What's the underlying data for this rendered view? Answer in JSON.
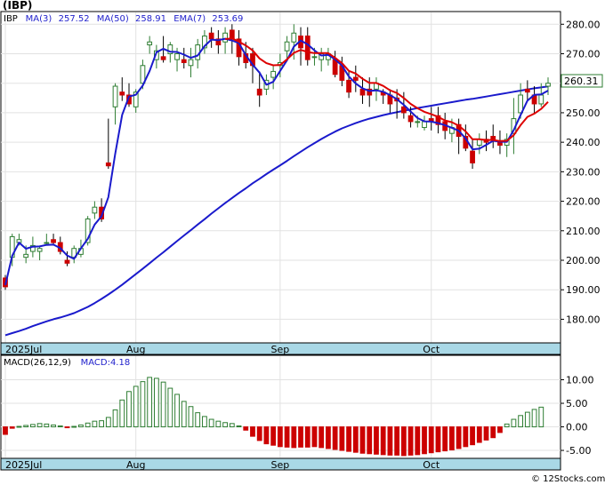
{
  "title": "(IBP)",
  "credit": "© 12Stocks.com",
  "legend": [
    {
      "label": "IBP",
      "color": "#000000"
    },
    {
      "label": "MA(3)",
      "color": "#2222cc"
    },
    {
      "label": "257.52",
      "color": "#2222cc"
    },
    {
      "label": "MA(50)",
      "color": "#2222cc"
    },
    {
      "label": "258.91",
      "color": "#2222cc"
    },
    {
      "label": "EMA(7)",
      "color": "#2222cc"
    },
    {
      "label": "253.69",
      "color": "#2222cc"
    }
  ],
  "macd_legend": [
    {
      "label": "MACD(26,12,9)",
      "color": "#000000"
    },
    {
      "label": "MACD:4.18",
      "color": "#2222cc"
    }
  ],
  "last_price_label": "260.31",
  "colors": {
    "up": "#2e7d32",
    "down": "#cc0000",
    "ma": "#1a1acc",
    "ema": "#dd0000",
    "axis_band": "#a9d8e6",
    "bg": "#ffffff"
  },
  "chart_data": [
    {
      "type": "candlestick",
      "title": "(IBP)",
      "ylim": [
        172,
        284
      ],
      "yticks": [
        180,
        190,
        200,
        210,
        220,
        230,
        240,
        250,
        260,
        270,
        280
      ],
      "ytick_labels": [
        "180.00",
        "190.00",
        "200.00",
        "210.00",
        "220.00",
        "230.00",
        "240.00",
        "250.00",
        "260.00",
        "270.00",
        "280.00"
      ],
      "xtick_labels": [
        {
          "label": "2025Jul",
          "index": 0
        },
        {
          "label": "Aug",
          "index": 19
        },
        {
          "label": "Sep",
          "index": 40
        },
        {
          "label": "Oct",
          "index": 62
        }
      ],
      "ohlc": [
        [
          194,
          195,
          190,
          191
        ],
        [
          201,
          209,
          198,
          208
        ],
        [
          206,
          209,
          205,
          207
        ],
        [
          201,
          205,
          199,
          202
        ],
        [
          203,
          208,
          201,
          205
        ],
        [
          203,
          205,
          200,
          204
        ],
        [
          206,
          209,
          205,
          206
        ],
        [
          207,
          209,
          205,
          206
        ],
        [
          206,
          208,
          202,
          203
        ],
        [
          200,
          203,
          198,
          199
        ],
        [
          201,
          205,
          199,
          204
        ],
        [
          202,
          207,
          201,
          204
        ],
        [
          206,
          215,
          205,
          214
        ],
        [
          216,
          220,
          214,
          218
        ],
        [
          218,
          221,
          213,
          214
        ],
        [
          233,
          248,
          231,
          232
        ],
        [
          252,
          260,
          246,
          259
        ],
        [
          257,
          262,
          254,
          256
        ],
        [
          256,
          260,
          252,
          253
        ],
        [
          252,
          258,
          250,
          257
        ],
        [
          260,
          268,
          258,
          266
        ],
        [
          273,
          276,
          270,
          274
        ],
        [
          268,
          273,
          265,
          271
        ],
        [
          269,
          276,
          267,
          268
        ],
        [
          270,
          274,
          267,
          273
        ],
        [
          268,
          272,
          264,
          270
        ],
        [
          268,
          272,
          265,
          267
        ],
        [
          266,
          272,
          262,
          268
        ],
        [
          268,
          275,
          265,
          273
        ],
        [
          272,
          278,
          270,
          276
        ],
        [
          277,
          279,
          272,
          275
        ],
        [
          275,
          278,
          270,
          273
        ],
        [
          274,
          279,
          270,
          277
        ],
        [
          278,
          280,
          270,
          275
        ],
        [
          275,
          278,
          266,
          269
        ],
        [
          270,
          274,
          265,
          267
        ],
        [
          270,
          272,
          260,
          266
        ],
        [
          258,
          264,
          252,
          256
        ],
        [
          258,
          263,
          256,
          261
        ],
        [
          262,
          266,
          258,
          264
        ],
        [
          266,
          270,
          262,
          267
        ],
        [
          271,
          276,
          268,
          274
        ],
        [
          274,
          280,
          268,
          277
        ],
        [
          276,
          279,
          266,
          272
        ],
        [
          276,
          279,
          266,
          268
        ],
        [
          269,
          272,
          266,
          269
        ],
        [
          268,
          272,
          264,
          270
        ],
        [
          268,
          272,
          266,
          270
        ],
        [
          268,
          271,
          262,
          263
        ],
        [
          266,
          269,
          259,
          261
        ],
        [
          261,
          264,
          255,
          257
        ],
        [
          262,
          266,
          257,
          261
        ],
        [
          258,
          262,
          253,
          256
        ],
        [
          258,
          262,
          252,
          256
        ],
        [
          258,
          262,
          254,
          260
        ],
        [
          257,
          258,
          253,
          256
        ],
        [
          256,
          258,
          250,
          253
        ],
        [
          255,
          258,
          248,
          254
        ],
        [
          252,
          257,
          248,
          250
        ],
        [
          249,
          252,
          245,
          247
        ],
        [
          247,
          249,
          245,
          247
        ],
        [
          245,
          249,
          244,
          247
        ],
        [
          248,
          252,
          244,
          247
        ],
        [
          249,
          252,
          243,
          246
        ],
        [
          247,
          250,
          241,
          244
        ],
        [
          243,
          248,
          240,
          245
        ],
        [
          246,
          248,
          236,
          242
        ],
        [
          242,
          246,
          237,
          238
        ],
        [
          237,
          241,
          231,
          233
        ],
        [
          239,
          243,
          236,
          241
        ],
        [
          241,
          244,
          237,
          240
        ],
        [
          242,
          246,
          238,
          241
        ],
        [
          240,
          244,
          236,
          239
        ],
        [
          239,
          243,
          235,
          241
        ],
        [
          243,
          255,
          236,
          248
        ],
        [
          250,
          260,
          248,
          256
        ],
        [
          258,
          261,
          254,
          257
        ],
        [
          256,
          259,
          250,
          253
        ],
        [
          253,
          260,
          252,
          256
        ],
        [
          259,
          262,
          256,
          260
        ]
      ],
      "series": [
        {
          "name": "MA(3)",
          "values": [
            191.6,
            201.5,
            206,
            203.9,
            204.6,
            204.7,
            205.2,
            205.3,
            204.1,
            201.6,
            200.5,
            204.0,
            207.3,
            212.1,
            214.9,
            221.4,
            236.1,
            249.3,
            255.5,
            256.1,
            259.2,
            264.2,
            270.5,
            271.7,
            270.7,
            270.6,
            269.7,
            268.6,
            269.4,
            272.6,
            274.8,
            274.6,
            275.1,
            274.5,
            273.6,
            269.5,
            266.3,
            263.6,
            259.5,
            260.5,
            264.2,
            267.8,
            272.4,
            274.5,
            273.2,
            271.1,
            269.4,
            269.6,
            268.1,
            266.0,
            262.3,
            259.9,
            258.3,
            257.4,
            257.6,
            257.1,
            256.0,
            254.6,
            252.7,
            250.4,
            248.2,
            247.1,
            247.0,
            246.5,
            245.8,
            244.9,
            243.9,
            241.3,
            237.6,
            237.8,
            239.1,
            240.5,
            240.2,
            240.1,
            244.1,
            249.2,
            254.1,
            256.1,
            256.2,
            257.52
          ]
        },
        {
          "name": "MA(50)",
          "values": [
            174.6,
            175.3,
            176.0,
            176.8,
            177.7,
            178.5,
            179.3,
            180.0,
            180.6,
            181.3,
            182.1,
            183.1,
            184.2,
            185.5,
            186.9,
            188.4,
            190.0,
            191.7,
            193.5,
            195.3,
            197.1,
            199.0,
            200.9,
            202.7,
            204.6,
            206.5,
            208.4,
            210.2,
            212.1,
            213.9,
            215.8,
            217.6,
            219.4,
            221.1,
            222.8,
            224.4,
            226.1,
            227.6,
            229.2,
            230.7,
            232.2,
            233.7,
            235.3,
            236.8,
            238.3,
            239.7,
            241.1,
            242.4,
            243.6,
            244.7,
            245.6,
            246.5,
            247.3,
            248.0,
            248.6,
            249.2,
            249.7,
            250.2,
            250.7,
            251.1,
            251.6,
            252.0,
            252.4,
            252.8,
            253.2,
            253.6,
            254.0,
            254.4,
            254.7,
            255.1,
            255.5,
            255.9,
            256.3,
            256.7,
            257.1,
            257.5,
            257.9,
            258.3,
            258.6,
            258.91
          ]
        },
        {
          "name": "EMA(7)",
          "values": [
            null,
            null,
            null,
            null,
            null,
            null,
            null,
            null,
            null,
            null,
            null,
            null,
            null,
            null,
            null,
            null,
            null,
            null,
            null,
            null,
            null,
            null,
            null,
            null,
            null,
            null,
            null,
            null,
            null,
            null,
            null,
            null,
            275.0,
            275.2,
            274.1,
            272.8,
            271.1,
            268.4,
            266.8,
            266.1,
            266.2,
            268.1,
            270.3,
            271.3,
            270.6,
            270.2,
            270.2,
            270.2,
            268.6,
            266.8,
            264.2,
            263.3,
            261.5,
            260.1,
            260.1,
            259.1,
            257.6,
            256.7,
            255.0,
            253.0,
            251.5,
            250.3,
            249.5,
            248.6,
            247.4,
            246.8,
            245.6,
            243.7,
            241.0,
            241.0,
            240.7,
            240.8,
            240.4,
            240.5,
            242.4,
            245.8,
            248.6,
            249.7,
            251.3,
            253.69
          ]
        }
      ]
    },
    {
      "type": "bar",
      "title": "MACD(26,12,9)",
      "ylim": [
        -6.5,
        15
      ],
      "yticks": [
        -5,
        0,
        5,
        10
      ],
      "ytick_labels": [
        "-5.00",
        "0.00",
        "5.00",
        "10.00"
      ],
      "xtick_labels": [
        {
          "label": "2025Jul",
          "index": 0
        },
        {
          "label": "Aug",
          "index": 19
        },
        {
          "label": "Sep",
          "index": 40
        },
        {
          "label": "Oct",
          "index": 62
        }
      ],
      "values": [
        -1.6,
        -0.3,
        0.1,
        0.3,
        0.5,
        0.7,
        0.6,
        0.4,
        0.2,
        -0.1,
        0.1,
        0.4,
        0.8,
        1.2,
        1.3,
        2.0,
        3.6,
        5.7,
        7.5,
        8.6,
        9.6,
        10.5,
        10.3,
        9.5,
        8.2,
        6.9,
        5.4,
        4.3,
        3.0,
        2.2,
        1.6,
        1.2,
        0.9,
        0.7,
        0.2,
        -0.7,
        -2.0,
        -2.9,
        -3.6,
        -3.9,
        -4.2,
        -4.3,
        -4.4,
        -4.3,
        -4.3,
        -4.2,
        -4.4,
        -4.6,
        -4.8,
        -5.0,
        -5.2,
        -5.4,
        -5.6,
        -5.7,
        -5.8,
        -5.9,
        -6.0,
        -6.0,
        -6.1,
        -6.0,
        -5.9,
        -5.7,
        -5.5,
        -5.3,
        -5.1,
        -4.9,
        -4.6,
        -4.2,
        -3.8,
        -3.3,
        -2.8,
        -2.3,
        -1.2,
        0.6,
        1.6,
        2.4,
        3.1,
        3.7,
        4.18
      ]
    }
  ]
}
